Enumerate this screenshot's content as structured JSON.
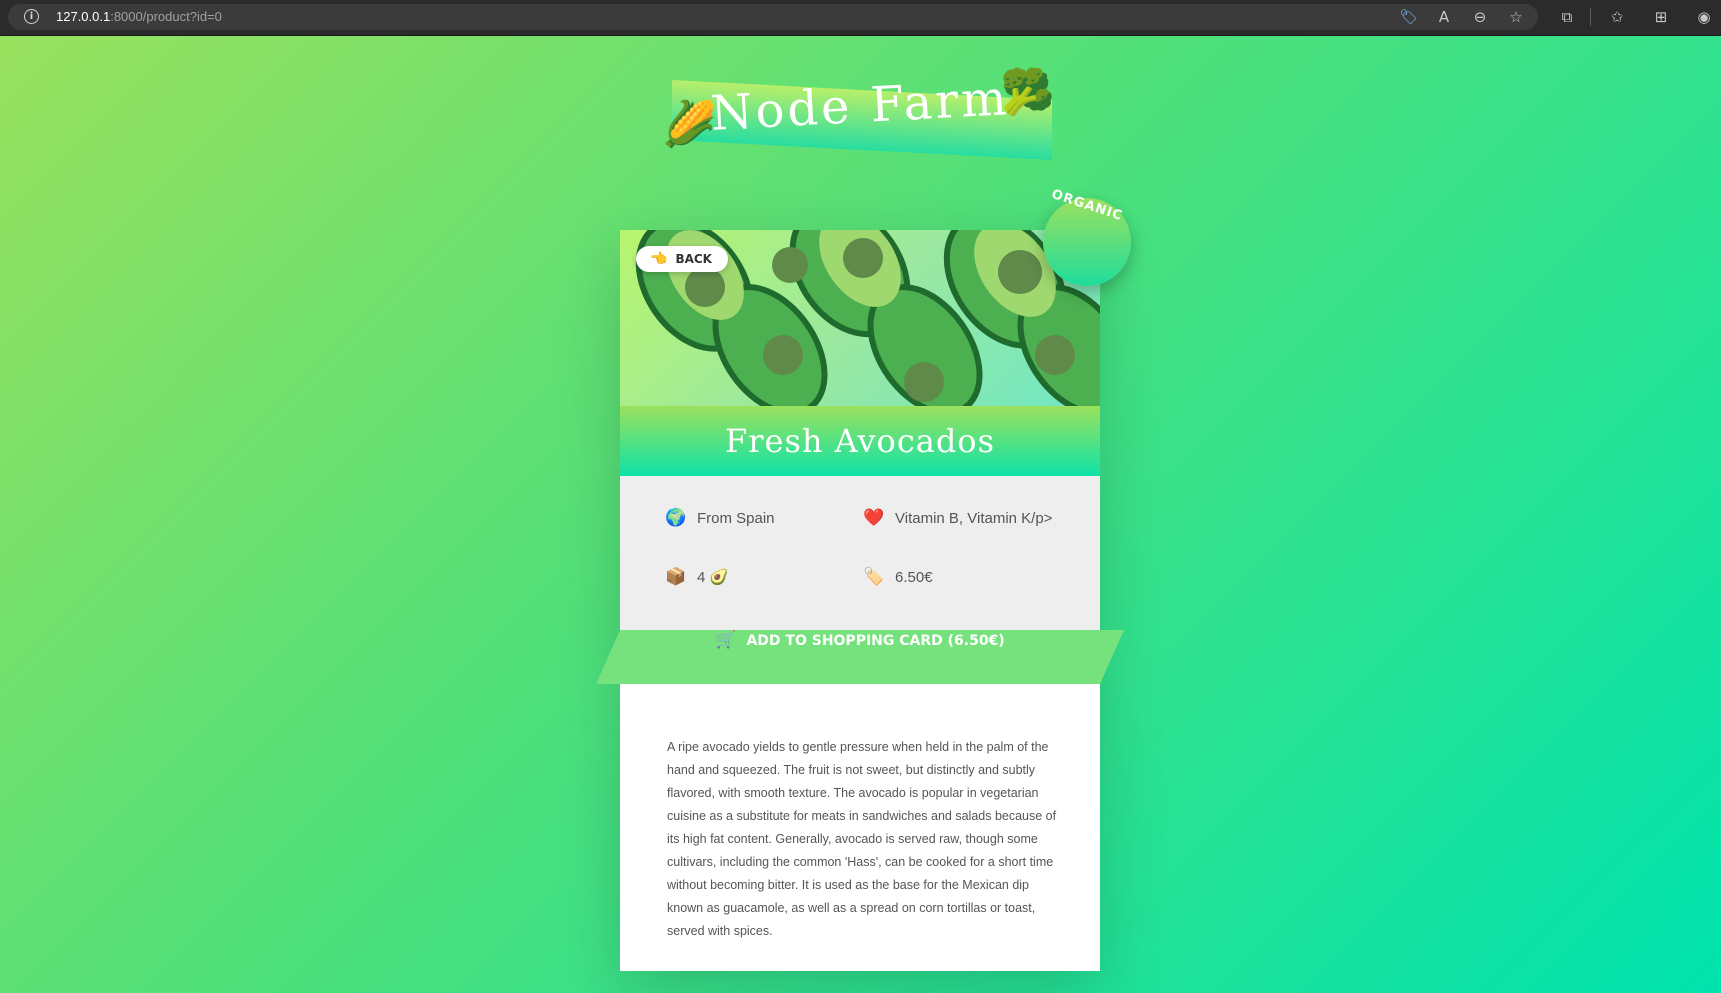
{
  "browser": {
    "url_host": "127.0.0.1",
    "url_rest": ":8000/product?id=0",
    "info_icon": "i"
  },
  "logo": {
    "text": "Node Farm",
    "left_emoji": "🌽",
    "right_emoji": "🥦"
  },
  "product": {
    "hero_icon": "avocado-pattern",
    "back_label": "BACK",
    "back_icon": "👈",
    "badge": "ORGANIC",
    "name": "Fresh Avocados",
    "from_icon": "🌍",
    "from": "From Spain",
    "nutrients_icon": "❤️",
    "nutrients": "Vitamin B, Vitamin K/p>",
    "quantity_icon": "📦",
    "quantity": "4 🥑",
    "price_icon": "🏷️",
    "price": "6.50€",
    "add_button": "ADD TO SHOPPING CARD (6.50€)",
    "cart_icon": "🛒",
    "description": "A ripe avocado yields to gentle pressure when held in the palm of the hand and squeezed. The fruit is not sweet, but distinctly and subtly flavored, with smooth texture. The avocado is popular in vegetarian cuisine as a substitute for meats in sandwiches and salads because of its high fat content. Generally, avocado is served raw, though some cultivars, including the common 'Hass', can be cooked for a short time without becoming bitter. It is used as the base for the Mexican dip known as guacamole, as well as a spread on corn tortillas or toast, served with spices."
  },
  "colors": {
    "bg_start": "#9be15d",
    "bg_end": "#00e3ae",
    "button": "#75e27d"
  }
}
